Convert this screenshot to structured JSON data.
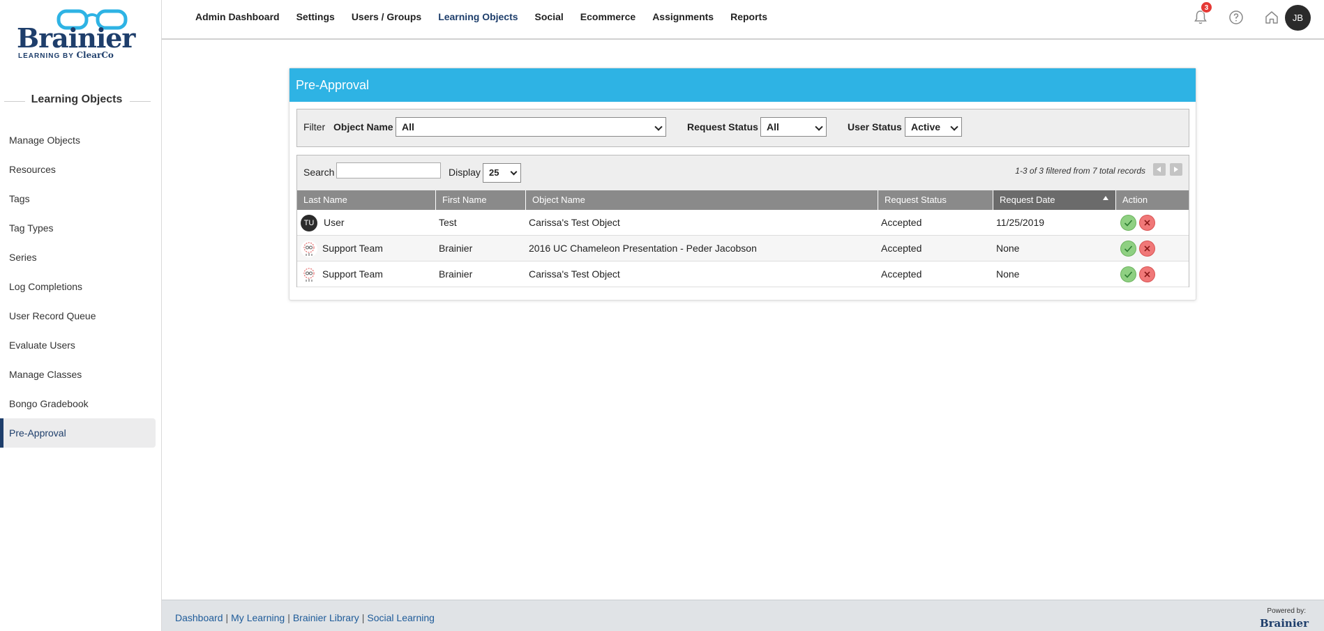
{
  "logo": {
    "brand": "Brainier",
    "tagline_prefix": "LEARNING BY ",
    "tagline_company": "ClearCo"
  },
  "sidebar": {
    "title": "Learning Objects",
    "items": [
      {
        "label": "Manage Objects"
      },
      {
        "label": "Resources"
      },
      {
        "label": "Tags"
      },
      {
        "label": "Tag Types"
      },
      {
        "label": "Series"
      },
      {
        "label": "Log Completions"
      },
      {
        "label": "User Record Queue"
      },
      {
        "label": "Evaluate Users"
      },
      {
        "label": "Manage Classes"
      },
      {
        "label": "Bongo Gradebook"
      },
      {
        "label": "Pre-Approval"
      }
    ],
    "active_index": 10
  },
  "topnav": {
    "items": [
      {
        "label": "Admin Dashboard"
      },
      {
        "label": "Settings"
      },
      {
        "label": "Users / Groups"
      },
      {
        "label": "Learning Objects"
      },
      {
        "label": "Social"
      },
      {
        "label": "Ecommerce"
      },
      {
        "label": "Assignments"
      },
      {
        "label": "Reports"
      }
    ],
    "active_index": 3,
    "notification_count": "3",
    "user_initials": "JB"
  },
  "panel": {
    "title": "Pre-Approval",
    "filter": {
      "label": "Filter",
      "object_name_label": "Object Name",
      "object_name_value": "All",
      "request_status_label": "Request Status",
      "request_status_value": "All",
      "user_status_label": "User Status",
      "user_status_value": "Active"
    },
    "controls": {
      "search_label": "Search",
      "search_value": "",
      "display_label": "Display",
      "display_value": "25",
      "records_text": "1-3 of 3 filtered from 7 total records"
    },
    "columns": [
      "Last Name",
      "First Name",
      "Object Name",
      "Request Status",
      "Request Date",
      "Action"
    ],
    "rows": [
      {
        "avatar": "TU",
        "last_name": "User",
        "first_name": "Test",
        "object_name": "Carissa's Test Object",
        "request_status": "Accepted",
        "request_date": "11/25/2019"
      },
      {
        "avatar": "",
        "last_name": "Support Team",
        "first_name": "Brainier",
        "object_name": "2016 UC Chameleon Presentation - Peder Jacobson",
        "request_status": "Accepted",
        "request_date": "None"
      },
      {
        "avatar": "",
        "last_name": "Support Team",
        "first_name": "Brainier",
        "object_name": "Carissa's Test Object",
        "request_status": "Accepted",
        "request_date": "None"
      }
    ]
  },
  "footer": {
    "links": [
      "Dashboard",
      "My Learning",
      "Brainier Library",
      "Social Learning"
    ],
    "separator": "|",
    "powered_by": "Powered by:",
    "powered_brand": "Brainier"
  },
  "colors": {
    "brand_navy": "#1e3e6b",
    "header_blue": "#2eb3e4",
    "accept_green": "#8fd082",
    "reject_red": "#f07878"
  }
}
